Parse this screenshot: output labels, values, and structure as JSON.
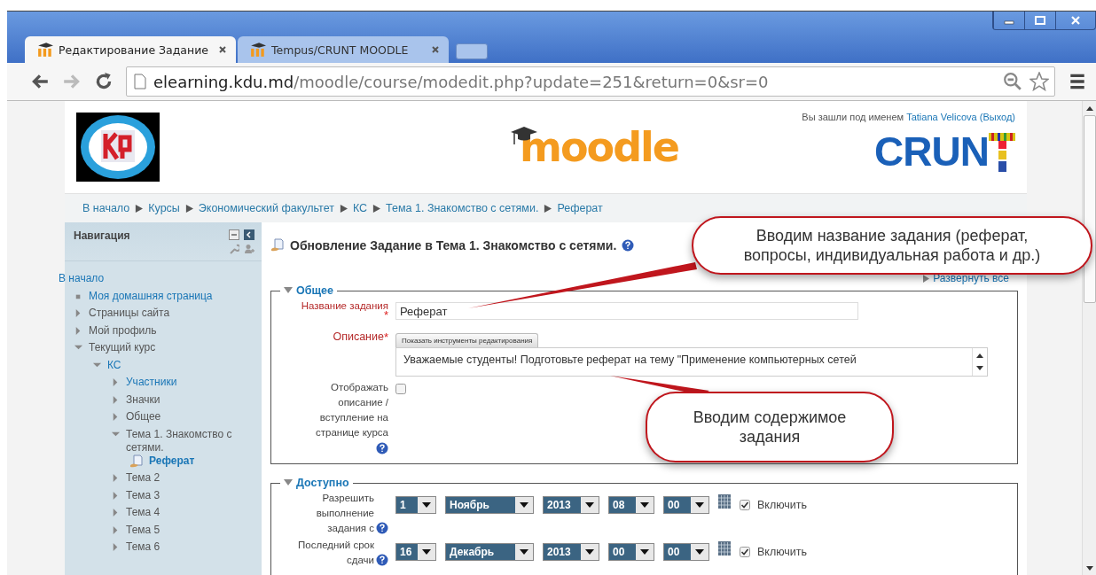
{
  "browser": {
    "tabs": [
      {
        "title": "Редактирование Задание",
        "selected": true
      },
      {
        "title": "Tempus/CRUNT MOODLE",
        "selected": false
      }
    ],
    "url_host": "elearning.kdu.md",
    "url_path": "/moodle/course/modedit.php?update=251&return=0&sr=0"
  },
  "header": {
    "login_prefix": "Вы зашли под именем",
    "user": "Tatiana Velicova",
    "logout": "(Выход)",
    "moodle_logo": "moodle",
    "crunt_logo": "CRUN"
  },
  "breadcrumb": [
    "В начало",
    "Курсы",
    "Экономический факультет",
    "КС",
    "Тема 1. Знакомство с сетями.",
    "Реферат"
  ],
  "nav": {
    "title": "Навигация",
    "items": [
      {
        "label": "В начало",
        "kind": "home",
        "link": true
      },
      {
        "label": "Моя домашняя страница",
        "kind": "bullet",
        "link": true
      },
      {
        "label": "Страницы сайта",
        "kind": "branch",
        "expanded": false,
        "link": false
      },
      {
        "label": "Мой профиль",
        "kind": "branch",
        "expanded": false,
        "link": false
      },
      {
        "label": "Текущий курс",
        "kind": "branch",
        "expanded": true,
        "link": false,
        "children": [
          {
            "label": "КС",
            "kind": "branch",
            "expanded": true,
            "link": true,
            "children": [
              {
                "label": "Участники",
                "kind": "branch",
                "expanded": false,
                "link": true
              },
              {
                "label": "Значки",
                "kind": "branch",
                "expanded": false,
                "link": false
              },
              {
                "label": "Общее",
                "kind": "branch",
                "expanded": false,
                "link": false
              },
              {
                "label": "Тема 1. Знакомство с сетями.",
                "kind": "branch",
                "expanded": true,
                "link": false,
                "children": [
                  {
                    "label": "Реферат",
                    "kind": "activity",
                    "link": true
                  }
                ]
              },
              {
                "label": "Тема 2",
                "kind": "branch",
                "expanded": false,
                "link": false
              },
              {
                "label": "Тема 3",
                "kind": "branch",
                "expanded": false,
                "link": false
              },
              {
                "label": "Тема 4",
                "kind": "branch",
                "expanded": false,
                "link": false
              },
              {
                "label": "Тема 5",
                "kind": "branch",
                "expanded": false,
                "link": false
              },
              {
                "label": "Тема 6",
                "kind": "branch",
                "expanded": false,
                "link": false
              }
            ]
          }
        ]
      }
    ]
  },
  "main": {
    "heading": "Обновление Задание в Тема 1. Знакомство с сетями.",
    "expand_all": "Развернуть все",
    "general": {
      "legend": "Общее",
      "expanded": true,
      "name_label": "Название задания",
      "required_mark": "*",
      "name_value": "Реферат",
      "desc_label": "Описание",
      "editor_button": "Показать инструменты редактирования",
      "desc_text": "Уважаемые студенты! Подготовьте реферат на тему \"Применение компьютерных сетей",
      "show_label": "Отображать описание / вступление на странице курса",
      "show_checked": false
    },
    "available": {
      "legend": "Доступно",
      "expanded": true,
      "rows": [
        {
          "label": "Разрешить выполнение задания с",
          "day": "1",
          "month": "Ноябрь",
          "year": "2013",
          "hour": "08",
          "minute": "00",
          "enabled": true,
          "enable_label": "Включить"
        },
        {
          "label": "Последний срок сдачи",
          "day": "16",
          "month": "Декабрь",
          "year": "2013",
          "hour": "00",
          "minute": "00",
          "enabled": true,
          "enable_label": "Включить"
        }
      ]
    }
  },
  "callouts": [
    {
      "text": "Вводим название задания (реферат, вопросы, индивидуальная работа и др.)"
    },
    {
      "text": "Вводим содержимое задания"
    }
  ]
}
